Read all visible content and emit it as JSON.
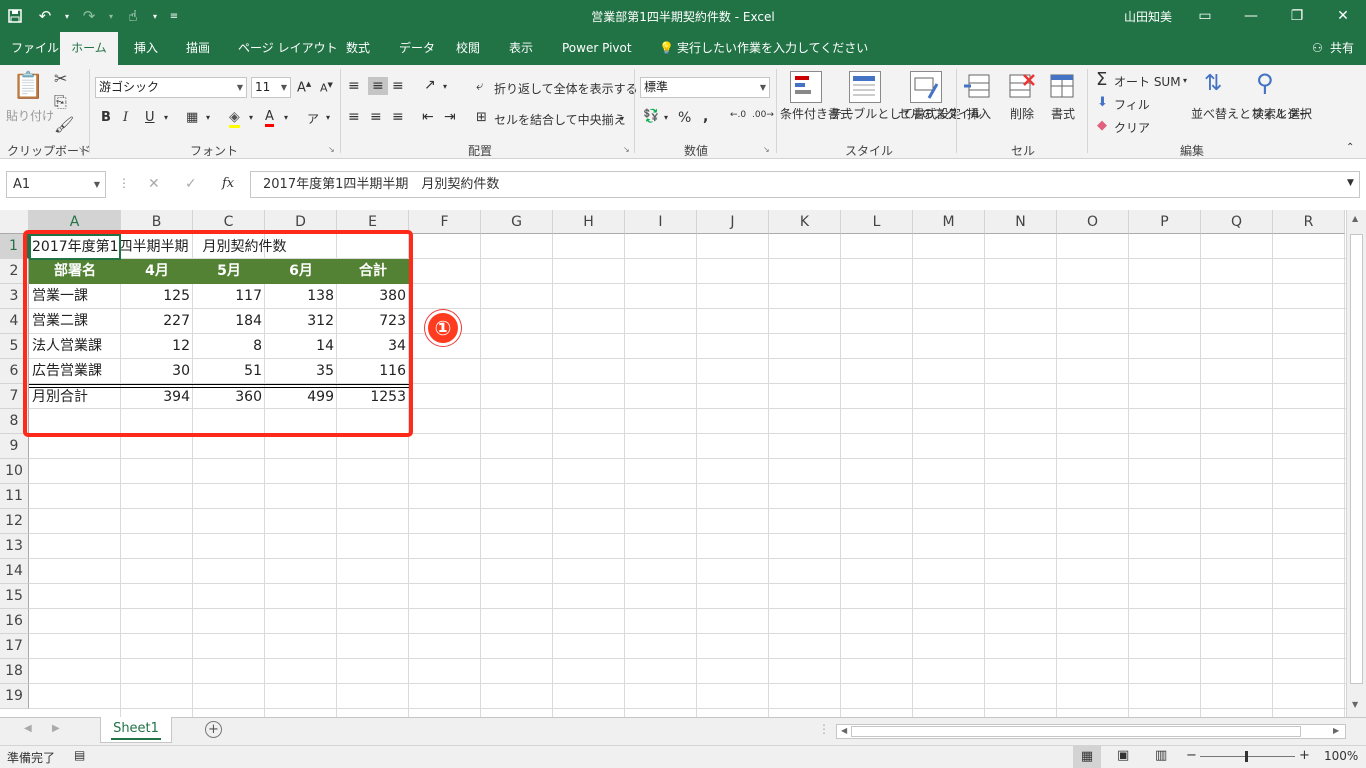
{
  "window": {
    "title": "営業部第1四半期契約件数  -  Excel",
    "user": "山田知美",
    "accent": "#217346"
  },
  "tabs": [
    {
      "label": "ファイル"
    },
    {
      "label": "ホーム"
    },
    {
      "label": "挿入"
    },
    {
      "label": "描画"
    },
    {
      "label": "ページ レイアウト"
    },
    {
      "label": "数式"
    },
    {
      "label": "データ"
    },
    {
      "label": "校閲"
    },
    {
      "label": "表示"
    },
    {
      "label": "Power Pivot"
    },
    {
      "label": "実行したい作業を入力してください"
    }
  ],
  "share_label": "共有",
  "ribbon": {
    "clipboard": {
      "paste": "貼り付け",
      "group": "クリップボード"
    },
    "font": {
      "name": "游ゴシック",
      "size": "11",
      "group": "フォント"
    },
    "alignment": {
      "wrap": "折り返して全体を表示する",
      "merge": "セルを結合して中央揃え",
      "group": "配置"
    },
    "number": {
      "format": "標準",
      "group": "数値"
    },
    "styles": {
      "conditional": "条件付き書式",
      "table": "テーブルとして書式設定",
      "cell": "セルのスタイル",
      "group": "スタイル"
    },
    "cells": {
      "insert": "挿入",
      "delete": "削除",
      "format": "書式",
      "group": "セル"
    },
    "editing": {
      "autosum": "オート SUM",
      "fill": "フィル",
      "clear": "クリア",
      "sort": "並べ替えとフィルター",
      "find": "検索と選択",
      "group": "編集"
    }
  },
  "formula_bar": {
    "name_box": "A1",
    "formula": "2017年度第1四半期半期　月別契約件数"
  },
  "columns": [
    "A",
    "B",
    "C",
    "D",
    "E",
    "F",
    "G",
    "H",
    "I",
    "J",
    "K",
    "L",
    "M",
    "N",
    "O",
    "P",
    "Q",
    "R"
  ],
  "rows": [
    "1",
    "2",
    "3",
    "4",
    "5",
    "6",
    "7",
    "8",
    "9",
    "10",
    "11",
    "12",
    "13",
    "14",
    "15",
    "16",
    "17",
    "18",
    "19"
  ],
  "sheet": {
    "title": "2017年度第1四半期半期　月別契約件数",
    "headers": [
      "部署名",
      "4月",
      "5月",
      "6月",
      "合計"
    ],
    "data": [
      [
        "営業一課",
        "125",
        "117",
        "138",
        "380"
      ],
      [
        "営業二課",
        "227",
        "184",
        "312",
        "723"
      ],
      [
        "法人営業課",
        "12",
        "8",
        "14",
        "34"
      ],
      [
        "広告営業課",
        "30",
        "51",
        "35",
        "116"
      ],
      [
        "月別合計",
        "394",
        "360",
        "499",
        "1253"
      ]
    ],
    "header_color": "#548235"
  },
  "annotation": {
    "badge": "①",
    "color": "#ff2a1a"
  },
  "sheet_tabs": [
    {
      "label": "Sheet1"
    }
  ],
  "status": {
    "ready": "準備完了",
    "zoom": "100%"
  }
}
